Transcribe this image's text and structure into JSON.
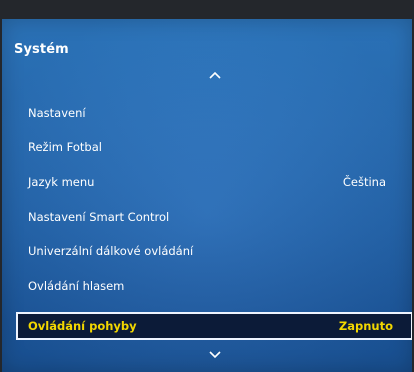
{
  "menu": {
    "title": "Systém",
    "items": [
      {
        "label": "Nastavení",
        "value": ""
      },
      {
        "label": "Režim Fotbal",
        "value": ""
      },
      {
        "label": "Jazyk menu",
        "value": "Čeština"
      },
      {
        "label": "Nastavení Smart Control",
        "value": ""
      },
      {
        "label": "Univerzální dálkové ovládání",
        "value": ""
      },
      {
        "label": "Ovládání hlasem",
        "value": ""
      },
      {
        "label": "Ovládání pohyby",
        "value": "Zapnuto"
      }
    ],
    "selected_index": 6
  },
  "icons": {
    "scroll_up": "chevron-up-icon",
    "scroll_down": "chevron-down-icon"
  },
  "colors": {
    "panel_blue": "#2b74c0",
    "selected_bg": "#0c1b38",
    "selected_text": "#f2d700",
    "text": "#ffffff"
  }
}
